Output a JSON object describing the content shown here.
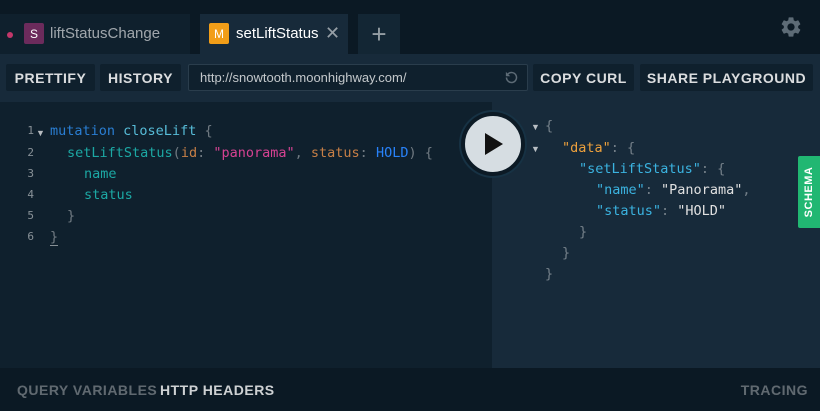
{
  "tabs": [
    {
      "badge": "S",
      "label": "liftStatusChange",
      "active": false
    },
    {
      "badge": "M",
      "label": "setLiftStatus",
      "active": true
    }
  ],
  "icons": {
    "close": "close-icon",
    "add": "plus-icon",
    "settings": "gear-icon",
    "reload": "reload-icon",
    "run": "play-icon"
  },
  "toolbar": {
    "prettify": "PRETTIFY",
    "history": "HISTORY",
    "endpoint_url": "http://snowtooth.moonhighway.com/",
    "copy_curl": "COPY CURL",
    "share": "SHARE PLAYGROUND"
  },
  "editor": {
    "line_numbers": [
      "1",
      "2",
      "3",
      "4",
      "5",
      "6"
    ],
    "query": {
      "op_keyword": "mutation",
      "op_name": "closeLift",
      "field": "setLiftStatus",
      "arg1_name": "id",
      "arg1_value": "\"panorama\"",
      "arg2_name": "status",
      "arg2_value": "HOLD",
      "sub_field1": "name",
      "sub_field2": "status"
    }
  },
  "result": {
    "key_data": "\"data\"",
    "key_field": "\"setLiftStatus\"",
    "key_name": "\"name\"",
    "val_name": "\"Panorama\"",
    "key_status": "\"status\"",
    "val_status": "\"HOLD\""
  },
  "schema_tab": "SCHEMA",
  "bottom": {
    "query_variables": "QUERY VARIABLES",
    "http_headers": "HTTP HEADERS",
    "tracing": "TRACING"
  },
  "colors": {
    "accent_green": "#21b772",
    "subscription_badge": "#6c2b5c",
    "mutation_badge": "#f29e18"
  }
}
